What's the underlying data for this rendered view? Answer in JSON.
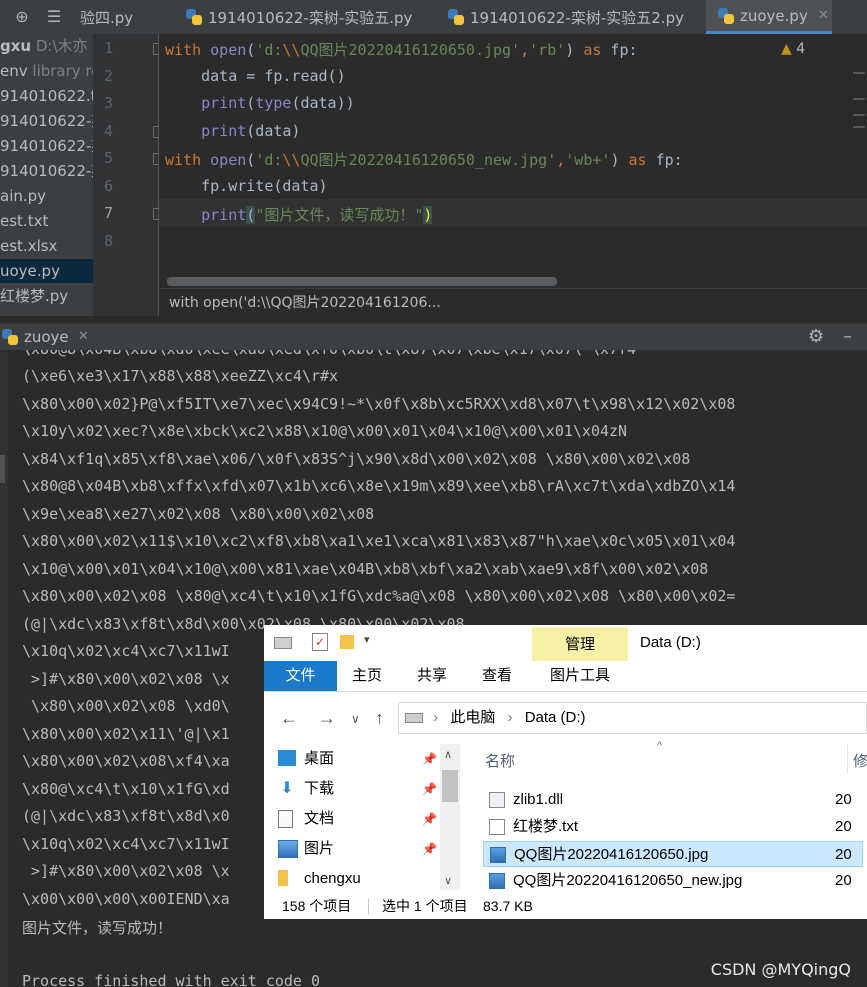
{
  "tabs": [
    {
      "label": "验四.py",
      "active": false
    },
    {
      "label": "1914010622-栾树-实验五.py",
      "active": false
    },
    {
      "label": "1914010622-栾树-实验五2.py",
      "active": false
    },
    {
      "label": "zuoye.py",
      "active": true
    }
  ],
  "project": {
    "items": [
      {
        "label": "gxu",
        "extra": "D:\\木亦",
        "bold": true
      },
      {
        "label": "env",
        "extra": "library ro"
      },
      {
        "label": "914010622.tx"
      },
      {
        "label": "914010622-栾"
      },
      {
        "label": "914010622-栾"
      },
      {
        "label": "914010622-栾"
      },
      {
        "label": "ain.py"
      },
      {
        "label": "est.txt"
      },
      {
        "label": "est.xlsx"
      },
      {
        "label": "uoye.py",
        "selected": true
      },
      {
        "label": "红楼梦.py"
      }
    ]
  },
  "editor": {
    "line_numbers": [
      "1",
      "2",
      "3",
      "4",
      "5",
      "6",
      "7",
      "8"
    ],
    "current_line": "7",
    "warnings": "4",
    "breadcrumb": "with open('d:\\\\QQ图片202204161206..."
  },
  "code": {
    "l1": {
      "kw1": "with",
      "sp1": " ",
      "bi1": "open",
      "p1": "(",
      "s1": "'d:",
      "e1": "\\\\",
      "s2": "QQ图片20220416120650.jpg'",
      "c1": ",",
      "s3": "'rb'",
      "p2": ") ",
      "kw2": "as",
      "rest": " fp:"
    },
    "l2": "    data = fp.read()",
    "l3": {
      "ind": "    ",
      "bi1": "print",
      "p1": "(",
      "bi2": "type",
      "rest": "(data))"
    },
    "l4": {
      "ind": "    ",
      "bi1": "print",
      "rest": "(data)"
    },
    "l5": {
      "kw1": "with",
      "sp1": " ",
      "bi1": "open",
      "p1": "(",
      "s1": "'d:",
      "e1": "\\\\",
      "s2": "QQ图片20220416120650_new.jpg'",
      "c1": ",",
      "s3": "'wb+'",
      "p2": ") ",
      "kw2": "as",
      "rest": " fp:"
    },
    "l6": "    fp.write(data)",
    "l7": {
      "ind": "    ",
      "bi1": "print",
      "p1": "(",
      "s1": "\"图片文件，读写成功！\"",
      "p2": ")"
    }
  },
  "run": {
    "tab_label": "zuoye",
    "output": [
      "\\x80@8\\x04B\\xb8\\xd0\\xee\\xa0\\xed\\xf0\\xb0\\t\\x87\\x07\\xbe\\x17\\x07\\ \\x7f4",
      "(\\xe6\\xe3\\x17\\x88\\x88\\xeeZZ\\xc4\\r#x",
      "\\x80\\x00\\x02}P@\\xf5IT\\xe7\\xec\\x94C9!~*\\x0f\\x8b\\xc5RXX\\xd8\\x07\\t\\x98\\x12\\x02\\x08",
      "\\x10y\\x02\\xec?\\x8e\\xbck\\xc2\\x88\\x10@\\x00\\x01\\x04\\x10@\\x00\\x01\\x04zN",
      "\\x84\\xf1q\\x85\\xf8\\xae\\x06/\\x0f\\x83S^j\\x90\\x8d\\x00\\x02\\x08 \\x80\\x00\\x02\\x08",
      "\\x80@8\\x04B\\xb8\\xffx\\xfd\\x07\\x1b\\xc6\\x8e\\x19m\\x89\\xee\\xb8\\rA\\xc7t\\xda\\xdbZO\\x14",
      "\\x9e\\xea8\\xe27\\x02\\x08 \\x80\\x00\\x02\\x08",
      "\\x80\\x00\\x02\\x11$\\x10\\xc2\\xf8\\xb8\\xa1\\xe1\\xca\\x81\\x83\\x87\"h\\xae\\x0c\\x05\\x01\\x04",
      "\\x10@\\x00\\x01\\x04\\x10@\\x00\\x81\\xae\\x04B\\xb8\\xbf\\xa2\\xab\\xae9\\x8f\\x00\\x02\\x08",
      "\\x80\\x00\\x02\\x08 \\x80@\\xc4\\t\\x10\\x1fG\\xdc%a@\\x08 \\x80\\x00\\x02\\x08 \\x80\\x00\\x02=",
      "(@|\\xdc\\x83\\xf8t\\x8d\\x00\\x02\\x08 \\x80\\x00\\x02\\x08",
      "\\x10q\\x02\\xc4\\xc7\\x11wI",
      " >]#\\x80\\x00\\x02\\x08 \\x",
      " \\x80\\x00\\x02\\x08 \\xd0\\",
      "\\x80\\x00\\x02\\x11\\'@|\\x1",
      "\\x80\\x00\\x02\\x08\\xf4\\xa",
      "\\x80@\\xc4\\t\\x10\\x1fG\\xd",
      "(@|\\xdc\\x83\\xf8t\\x8d\\x0",
      "\\x10q\\x02\\xc4\\xc7\\x11wI",
      " >]#\\x80\\x00\\x02\\x08 \\x",
      "\\x00\\x00\\x00\\x00IEND\\xa",
      "图片文件，读写成功！",
      "",
      "Process finished with exit code 0"
    ]
  },
  "watermark": "CSDN @MYQingQ",
  "explorer": {
    "title": "Data (D:)",
    "manage_label": "管理",
    "ribbon_tabs": [
      "文件",
      "主页",
      "共享",
      "查看",
      "图片工具"
    ],
    "path": [
      "此电脑",
      "Data (D:)"
    ],
    "nav_items": [
      {
        "label": "桌面",
        "icon": "desktop-icon"
      },
      {
        "label": "下载",
        "icon": "download-icon"
      },
      {
        "label": "文档",
        "icon": "document-icon"
      },
      {
        "label": "图片",
        "icon": "picture-icon"
      },
      {
        "label": "chengxu",
        "icon": "folder-icon"
      }
    ],
    "columns": [
      "名称",
      "修"
    ],
    "files": [
      {
        "name": "zlib1.dll",
        "col2": "20",
        "type": "dll",
        "selected": false
      },
      {
        "name": "红楼梦.txt",
        "col2": "20",
        "type": "txt",
        "selected": false
      },
      {
        "name": "QQ图片20220416120650.jpg",
        "col2": "20",
        "type": "jpg",
        "selected": true
      },
      {
        "name": "QQ图片20220416120650_new.jpg",
        "col2": "20",
        "type": "jpg",
        "selected": false
      }
    ],
    "status": {
      "count": "158 个项目",
      "selected": "选中 1 个项目",
      "size": "83.7 KB"
    }
  }
}
